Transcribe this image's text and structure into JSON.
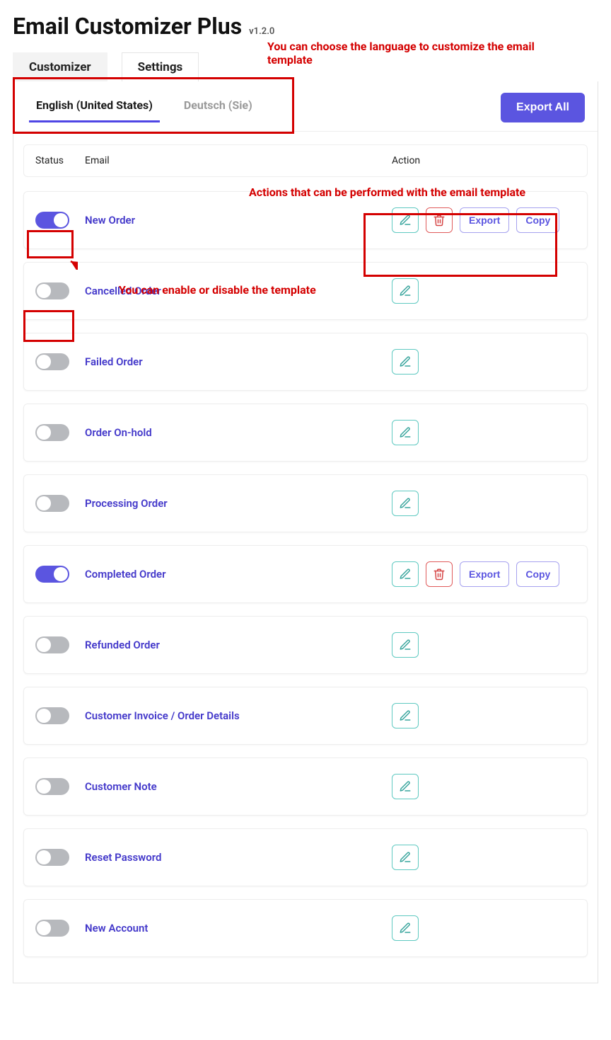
{
  "app": {
    "title": "Email Customizer Plus",
    "version": "v1.2.0"
  },
  "top_tabs": {
    "customizer": "Customizer",
    "settings": "Settings"
  },
  "lang_tabs": [
    {
      "label": "English (United States)",
      "active": true
    },
    {
      "label": "Deutsch (Sie)",
      "active": false
    }
  ],
  "buttons": {
    "export_all": "Export All",
    "export": "Export",
    "copy": "Copy"
  },
  "columns": {
    "status": "Status",
    "email": "Email",
    "action": "Action"
  },
  "rows": [
    {
      "name": "New Order",
      "enabled": true,
      "actions": [
        "edit",
        "delete",
        "export",
        "copy"
      ]
    },
    {
      "name": "Cancelled Order",
      "enabled": false,
      "actions": [
        "edit"
      ]
    },
    {
      "name": "Failed Order",
      "enabled": false,
      "actions": [
        "edit"
      ]
    },
    {
      "name": "Order On-hold",
      "enabled": false,
      "actions": [
        "edit"
      ]
    },
    {
      "name": "Processing Order",
      "enabled": false,
      "actions": [
        "edit"
      ]
    },
    {
      "name": "Completed Order",
      "enabled": true,
      "actions": [
        "edit",
        "delete",
        "export",
        "copy"
      ]
    },
    {
      "name": "Refunded Order",
      "enabled": false,
      "actions": [
        "edit"
      ]
    },
    {
      "name": "Customer Invoice / Order Details",
      "enabled": false,
      "actions": [
        "edit"
      ]
    },
    {
      "name": "Customer Note",
      "enabled": false,
      "actions": [
        "edit"
      ]
    },
    {
      "name": "Reset Password",
      "enabled": false,
      "actions": [
        "edit"
      ]
    },
    {
      "name": "New Account",
      "enabled": false,
      "actions": [
        "edit"
      ]
    }
  ],
  "annotations": {
    "lang": "You can choose the language to customize the email template",
    "actions": "Actions that can be performed with the email template",
    "toggle": "You can enable or disable the template"
  }
}
